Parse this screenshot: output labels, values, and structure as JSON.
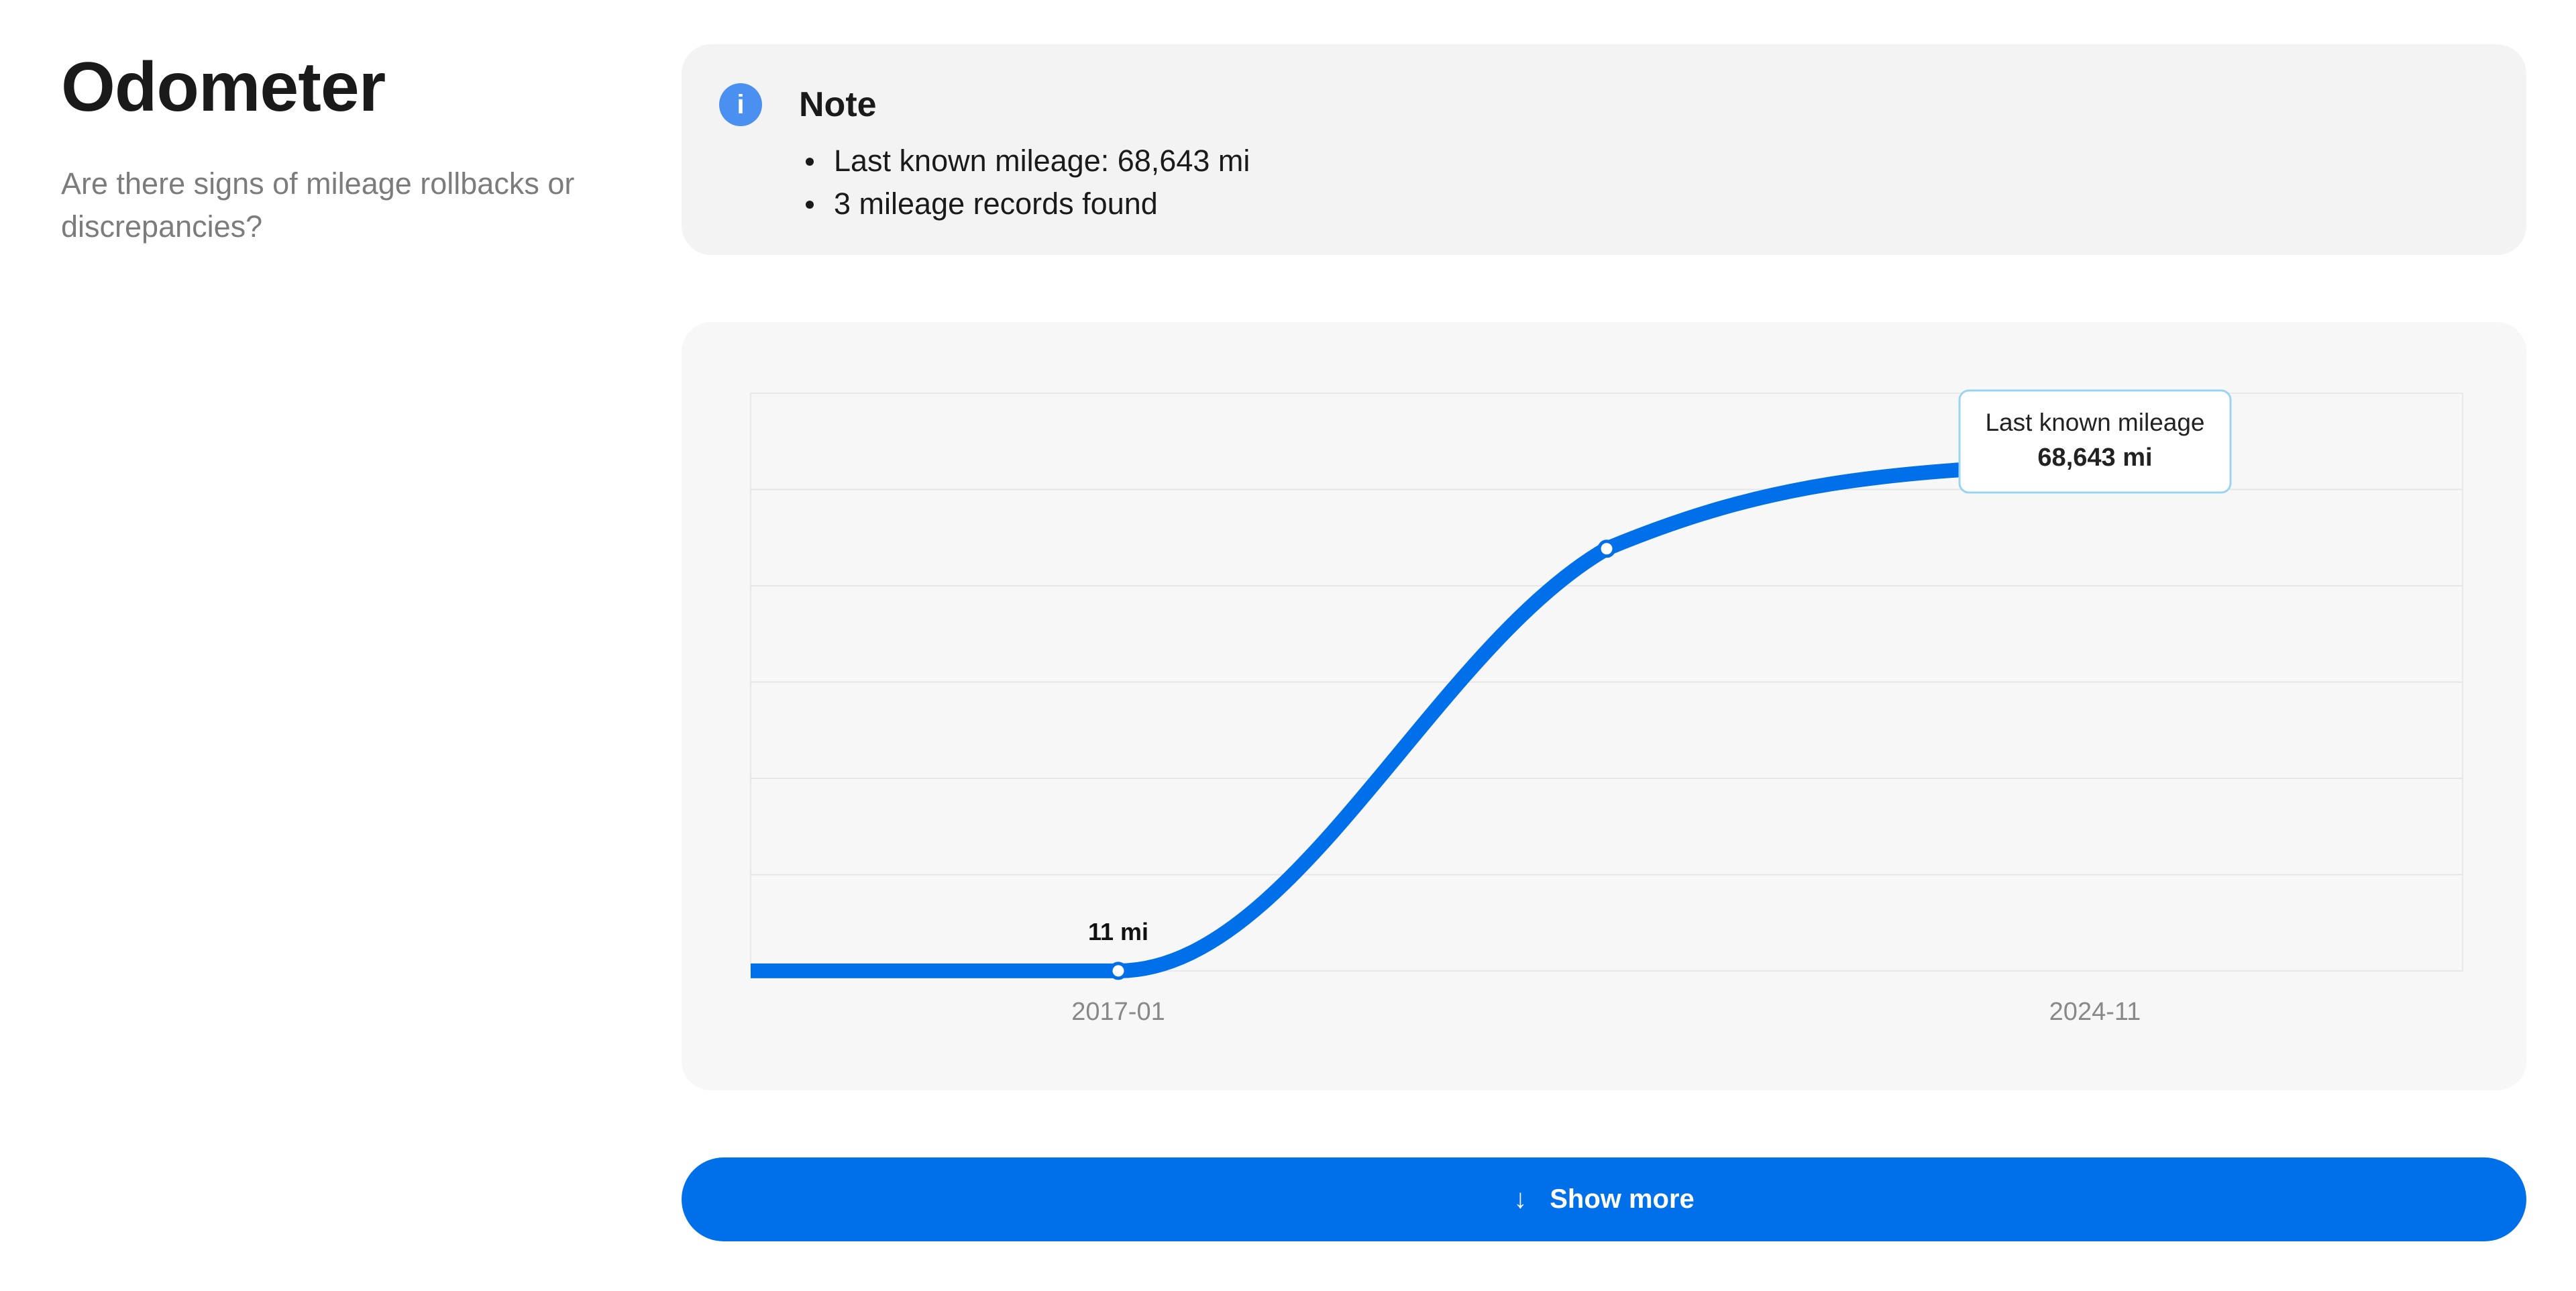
{
  "section": {
    "title": "Odometer",
    "subtitle": "Are there signs of mileage rollbacks or discrepancies?"
  },
  "note": {
    "icon": "info-icon",
    "title": "Note",
    "items": [
      "Last known mileage: 68,643 mi",
      "3 mileage records found"
    ]
  },
  "chart_data": {
    "type": "line",
    "x": [
      "2017-01",
      "2020-12",
      "2024-11"
    ],
    "values": [
      11,
      57000,
      68643
    ],
    "x_tick_labels": [
      "2017-01",
      "2024-11"
    ],
    "y_max_reference": 78000,
    "grid": true,
    "line_color": "#0070ea",
    "point_labels": {
      "first": "11 mi"
    },
    "tooltip": {
      "title": "Last known mileage",
      "value": "68,643 mi"
    }
  },
  "actions": {
    "show_more_label": "Show more",
    "show_more_icon": "arrow-down-icon"
  },
  "colors": {
    "accent": "#0070ea",
    "info": "#4a90f0",
    "tooltip_border": "#9ad4f0"
  }
}
